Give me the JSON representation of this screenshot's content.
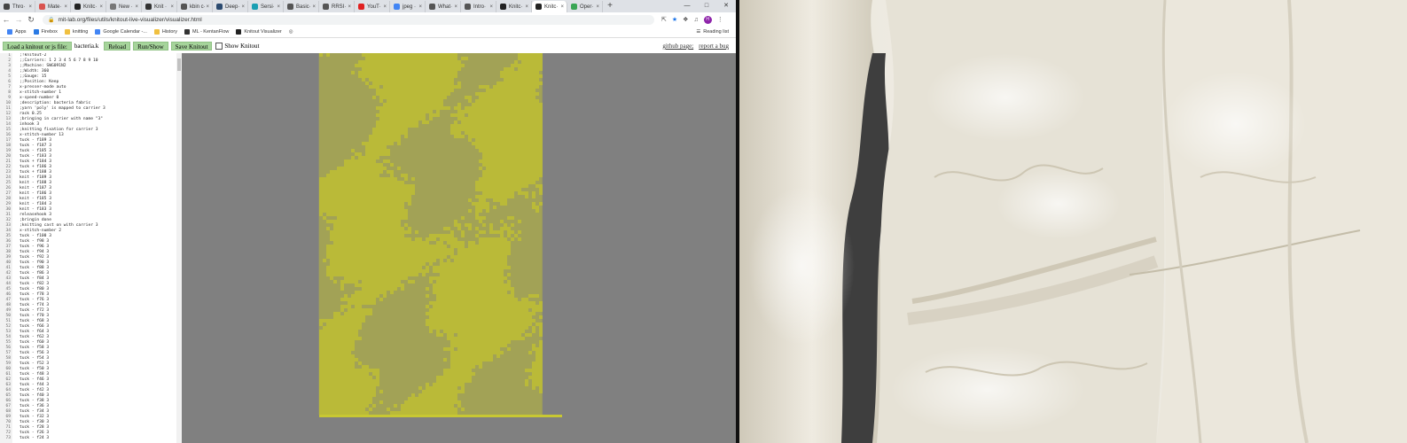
{
  "browser": {
    "tabs": [
      {
        "title": "Thro·",
        "favicon_color": "#444444"
      },
      {
        "title": "Mate·",
        "favicon_color": "#d9534f"
      },
      {
        "title": "Knitc·",
        "favicon_color": "#222222"
      },
      {
        "title": "New ·",
        "favicon_color": "#777777"
      },
      {
        "title": "Knit ·",
        "favicon_color": "#333333"
      },
      {
        "title": "kbin c·",
        "favicon_color": "#555555"
      },
      {
        "title": "Deep·",
        "favicon_color": "#2b4a6f"
      },
      {
        "title": "Sersi·",
        "favicon_color": "#1a9fb3"
      },
      {
        "title": "Basic·",
        "favicon_color": "#555555"
      },
      {
        "title": "RRSI·",
        "favicon_color": "#555555"
      },
      {
        "title": "YouT·",
        "favicon_color": "#e02020"
      },
      {
        "title": "jpeg ·",
        "favicon_color": "#4285f4"
      },
      {
        "title": "What·",
        "favicon_color": "#555555"
      },
      {
        "title": "Intro·",
        "favicon_color": "#555555"
      },
      {
        "title": "Knitc·",
        "favicon_color": "#222222"
      },
      {
        "title": "Knitc·",
        "favicon_color": "#222222"
      },
      {
        "title": "Oper·",
        "favicon_color": "#3aa655"
      }
    ],
    "active_tab_index": 15,
    "new_tab": "+",
    "url": "mit-lab.org/files/utils/knitout-live-visualizer/visualizer.html",
    "avatar": "H",
    "bookmarks": [
      {
        "label": "Apps",
        "color": "#4285f4"
      },
      {
        "label": "Firebox",
        "color": "#2a7ae4"
      },
      {
        "label": "knitting",
        "color": "#f0c040"
      },
      {
        "label": "Google Calendar -...",
        "color": "#4285f4"
      },
      {
        "label": "History",
        "color": "#f0c040"
      },
      {
        "label": "ML - KentanFlow",
        "color": "#333333"
      },
      {
        "label": "Knitout Visualizer",
        "color": "#222222"
      }
    ],
    "reading_list": "Reading list"
  },
  "toolbar": {
    "load_label": "Load a knitout or js file:",
    "filename": "bacteria.k",
    "reload_label": "Reload",
    "runshow_label": "Run/Show",
    "save_label": "Save Knitout",
    "show_knitout_label": "Show Knitout",
    "github_label": "github page;",
    "bug_label": "report a bug",
    "button_color": "#a6d49b"
  },
  "editor": {
    "lines": [
      ";!knitout-2",
      ";;Carriers: 1 2 3 4 5 6 7 8 9 10",
      ";;Machine: SWG091N2",
      ";;Width: 360",
      ";;Gauge: 15",
      ";;Position: Keep",
      "x-presser-mode auto",
      "x-stitch-number 1",
      "x-speed-number 0",
      ";description: bacteria fabric",
      ";yarn 'poly' is mapped to carrier 3",
      "rack 0.25",
      ";bringing in carrier with name \"3\"",
      "inhook 3",
      ";knitting fixation for carrier 3",
      "x-stitch-number 13",
      "tuck - f189 3",
      "tuck - f187 3",
      "tuck - f185 3",
      "tuck - f183 3",
      "tuck + f184 3",
      "tuck + f186 3",
      "tuck + f188 3",
      "knit - f189 3",
      "knit - f188 3",
      "knit - f187 3",
      "knit - f186 3",
      "knit - f185 3",
      "knit - f184 3",
      "knit - f183 3",
      "releasehook 3",
      ";bringin done",
      ";knitting cast on with carrier 3",
      "x-stitch-number 2",
      "tuck - f100 3",
      "tuck - f98 3",
      "tuck - f96 3",
      "tuck - f94 3",
      "tuck - f92 3",
      "tuck - f90 3",
      "tuck - f88 3",
      "tuck - f86 3",
      "tuck - f84 3",
      "tuck - f82 3",
      "tuck - f80 3",
      "tuck - f78 3",
      "tuck - f76 3",
      "tuck - f74 3",
      "tuck - f72 3",
      "tuck - f70 3",
      "tuck - f68 3",
      "tuck - f66 3",
      "tuck - f64 3",
      "tuck - f62 3",
      "tuck - f60 3",
      "tuck - f58 3",
      "tuck - f56 3",
      "tuck - f54 3",
      "tuck - f52 3",
      "tuck - f50 3",
      "tuck - f48 3",
      "tuck - f46 3",
      "tuck - f44 3",
      "tuck - f42 3",
      "tuck - f40 3",
      "tuck - f38 3",
      "tuck - f36 3",
      "tuck - f34 3",
      "tuck - f32 3",
      "tuck - f30 3",
      "tuck - f28 3",
      "tuck - f26 3",
      "tuck - f24 3"
    ]
  },
  "visualizer": {
    "background": "#808080",
    "yarn_color": "#c8c832"
  },
  "photo": {
    "colors": {
      "fabric_light": "#efece2",
      "fabric_mid": "#d6d1c2",
      "shadow": "#3e3e3e"
    }
  }
}
